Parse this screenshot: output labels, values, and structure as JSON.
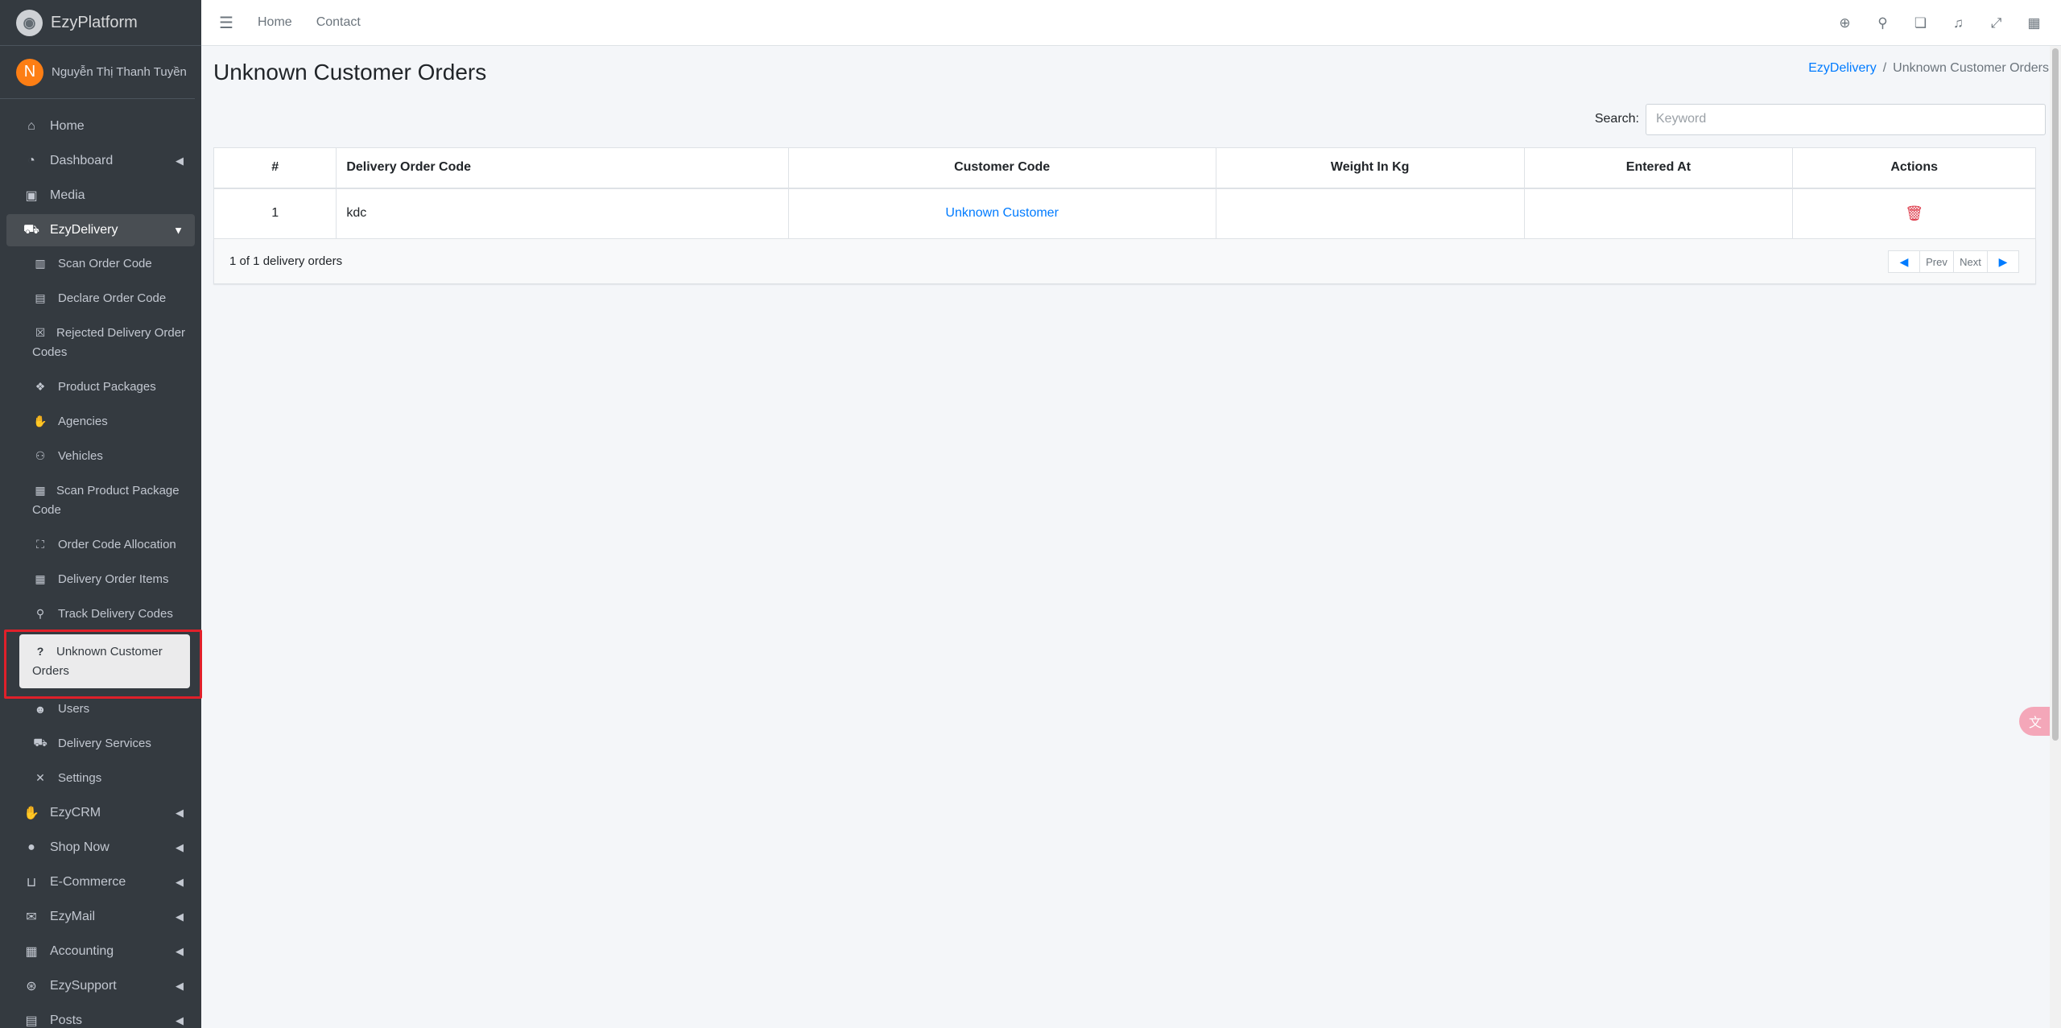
{
  "brand": {
    "name": "EzyPlatform"
  },
  "user": {
    "initial": "N",
    "name": "Nguyễn Thị Thanh Tuyền"
  },
  "sidebar": {
    "items": [
      {
        "label": "Home",
        "icon": "home-icon"
      },
      {
        "label": "Dashboard",
        "icon": "dashboard-icon"
      },
      {
        "label": "Media",
        "icon": "image-icon"
      },
      {
        "label": "EzyDelivery",
        "icon": "truck-icon"
      },
      {
        "label": "Scan Order Code",
        "icon": "barcode-icon"
      },
      {
        "label": "Declare Order Code",
        "icon": "file-icon"
      },
      {
        "label": "Rejected Delivery Order Codes",
        "icon": "x-square-icon"
      },
      {
        "label": "Product Packages",
        "icon": "cubes-icon"
      },
      {
        "label": "Agencies",
        "icon": "handshake-icon"
      },
      {
        "label": "Vehicles",
        "icon": "motorcycle-icon"
      },
      {
        "label": "Scan Product Package Code",
        "icon": "qrcode-icon"
      },
      {
        "label": "Order Code Allocation",
        "icon": "sitemap-icon"
      },
      {
        "label": "Delivery Order Items",
        "icon": "table-icon"
      },
      {
        "label": "Track Delivery Codes",
        "icon": "search-icon"
      },
      {
        "label": "Unknown Customer Orders",
        "icon": "question-icon"
      },
      {
        "label": "Users",
        "icon": "users-icon"
      },
      {
        "label": "Delivery Services",
        "icon": "truck-icon"
      },
      {
        "label": "Settings",
        "icon": "tools-icon"
      },
      {
        "label": "EzyCRM",
        "icon": "handshake-icon"
      },
      {
        "label": "Shop Now",
        "icon": "circle-icon"
      },
      {
        "label": "E-Commerce",
        "icon": "basket-icon"
      },
      {
        "label": "EzyMail",
        "icon": "envelope-icon"
      },
      {
        "label": "Accounting",
        "icon": "calculator-icon"
      },
      {
        "label": "EzySupport",
        "icon": "lifering-icon"
      },
      {
        "label": "Posts",
        "icon": "newspaper-icon"
      }
    ]
  },
  "topbar": {
    "home": "Home",
    "contact": "Contact"
  },
  "page": {
    "title": "Unknown Customer Orders",
    "breadcrumb": {
      "parent": "EzyDelivery",
      "sep": "/",
      "current": "Unknown Customer Orders"
    }
  },
  "search": {
    "label": "Search:",
    "placeholder": "Keyword",
    "value": ""
  },
  "table": {
    "headers": [
      "#",
      "Delivery Order Code",
      "Customer Code",
      "Weight In Kg",
      "Entered At",
      "Actions"
    ],
    "rows": [
      {
        "num": "1",
        "code": "kdc",
        "customer": "Unknown Customer",
        "weight": "",
        "entered": ""
      }
    ]
  },
  "footer": {
    "summary": "1 of 1 delivery orders",
    "prev": "Prev",
    "next": "Next"
  },
  "colors": {
    "sidebar": "#343a40",
    "accent": "#007bff",
    "danger": "#dc3545",
    "highlight": "#e0202a"
  }
}
